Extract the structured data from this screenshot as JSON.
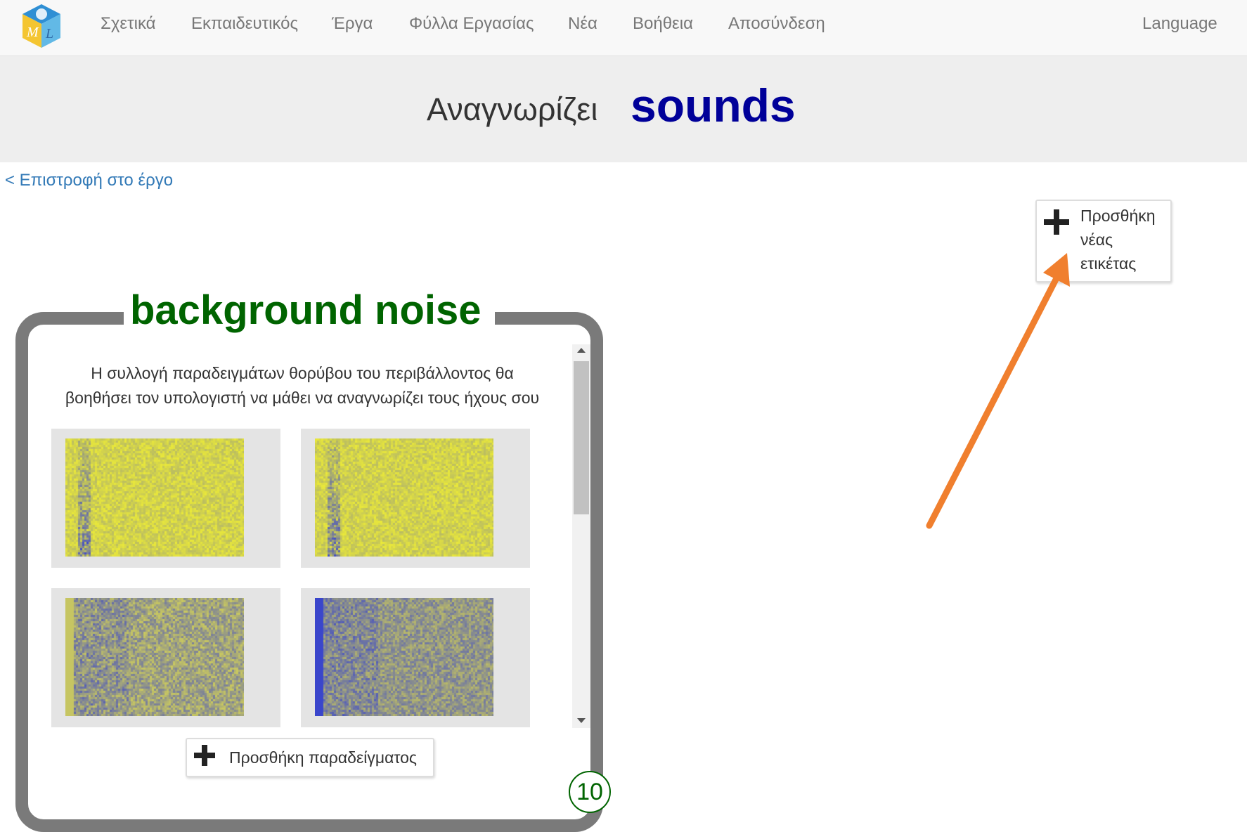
{
  "navbar": {
    "items": [
      {
        "label": "Σχετικά"
      },
      {
        "label": "Εκπαιδευτικός"
      },
      {
        "label": "Έργα"
      },
      {
        "label": "Φύλλα Εργασίας"
      },
      {
        "label": "Νέα"
      },
      {
        "label": "Βοήθεια"
      },
      {
        "label": "Αποσύνδεση"
      }
    ],
    "language_label": "Language",
    "logo_letters": "ML"
  },
  "header": {
    "prefix": "Αναγνωρίζει",
    "type": "sounds"
  },
  "back_link": "< Επιστροφή στο έργο",
  "add_label_button": {
    "lines": [
      "Προσθήκη",
      "νέας",
      "ετικέτας"
    ]
  },
  "label_card": {
    "title": "background noise",
    "description_lines": [
      "Η συλλογή παραδειγμάτων θορύβου του περιβάλλοντος θα",
      "βοηθήσει τον υπολογιστή να μάθει να αναγνωρίζει τους ήχους σου"
    ],
    "add_example_label": "Προσθήκη παραδείγματος",
    "example_count": "10",
    "samples": [
      {
        "icon": "spectrogram-image",
        "yellow": "#e9e83a",
        "blue": "#2f3bd6"
      },
      {
        "icon": "spectrogram-image",
        "yellow": "#e9e83a",
        "blue": "#2f3bd6"
      },
      {
        "icon": "spectrogram-image",
        "yellow": "#c9c860",
        "blue": "#3a45c8"
      },
      {
        "icon": "spectrogram-image",
        "yellow": "#b8b86a",
        "blue": "#3340d0"
      }
    ]
  },
  "colors": {
    "accent_title": "#006400",
    "header_strong": "#000099",
    "annotation_arrow": "#f07f2e",
    "link": "#337ab7"
  }
}
